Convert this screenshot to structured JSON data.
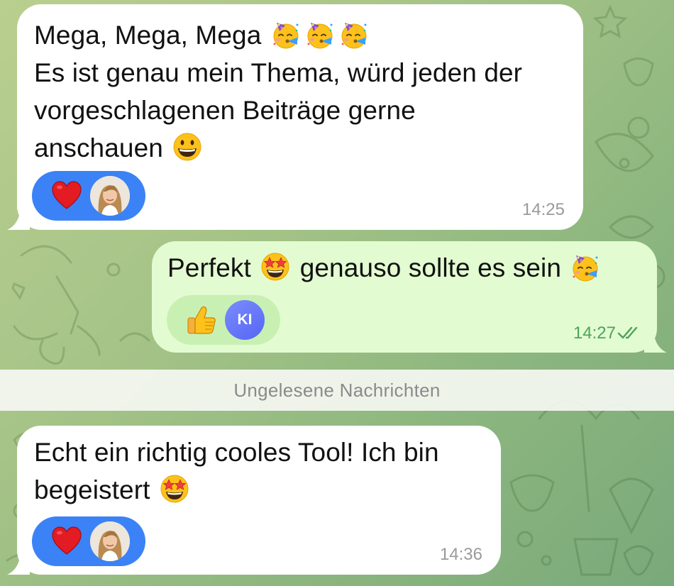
{
  "chat": {
    "divider_label": "Ungelesene Nachrichten",
    "messages": [
      {
        "direction": "incoming",
        "line1": "Mega, Mega, Mega",
        "line2": "Es ist genau mein Thema, würd jeden der",
        "line3": "vorgeschlagenen Beiträge gerne",
        "line4": "anschauen",
        "emojis": [
          "partying-face",
          "partying-face",
          "partying-face",
          "grinning-face"
        ],
        "reaction": {
          "emoji": "red-heart",
          "by": "avatar-photo"
        },
        "time": "14:25"
      },
      {
        "direction": "outgoing",
        "text_part1": "Perfekt",
        "text_part2": "genauso sollte es sein",
        "emojis": [
          "star-struck",
          "partying-face"
        ],
        "reaction": {
          "emoji": "thumbs-up",
          "by_label": "KI"
        },
        "time": "14:27",
        "status": "read-double-check"
      },
      {
        "direction": "incoming",
        "line1": "Echt ein richtig cooles Tool! Ich bin",
        "line2": "begeistert",
        "emojis": [
          "star-struck"
        ],
        "reaction": {
          "emoji": "red-heart",
          "by": "avatar-photo"
        },
        "time": "14:36"
      }
    ]
  },
  "colors": {
    "incoming_bubble": "#ffffff",
    "outgoing_bubble": "#e3fbd1",
    "reaction_blue": "#3b82f6",
    "reaction_green": "#c9f0b3",
    "time_outgoing": "#4da35a",
    "ki_badge": "#5f6ff7"
  }
}
